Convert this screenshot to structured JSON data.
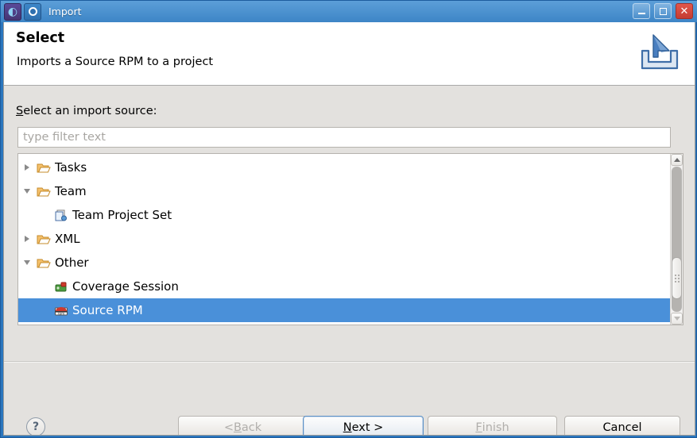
{
  "window": {
    "title": "Import",
    "app_icon": "eclipse-icon",
    "doc_icon": "app-ring-icon",
    "controls": {
      "minimize": "minimize-icon",
      "maximize": "maximize-icon",
      "close": "close-icon",
      "close_glyph": "✕"
    }
  },
  "banner": {
    "title": "Select",
    "subtitle": "Imports a Source RPM to a project",
    "icon": "import-tray-icon"
  },
  "form": {
    "source_label_prefix": "S",
    "source_label_rest": "elect an import source:",
    "filter": {
      "value": "",
      "placeholder": "type filter text"
    }
  },
  "tree": {
    "items": [
      {
        "label": "Tasks",
        "icon": "folder-icon",
        "twisty": "collapsed",
        "depth": 0,
        "selected": false
      },
      {
        "label": "Team",
        "icon": "folder-icon",
        "twisty": "expanded",
        "depth": 0,
        "selected": false
      },
      {
        "label": "Team Project Set",
        "icon": "team-project-set-icon",
        "twisty": "none",
        "depth": 1,
        "selected": false
      },
      {
        "label": "XML",
        "icon": "folder-icon",
        "twisty": "collapsed",
        "depth": 0,
        "selected": false
      },
      {
        "label": "Other",
        "icon": "folder-icon",
        "twisty": "expanded",
        "depth": 0,
        "selected": false
      },
      {
        "label": "Coverage Session",
        "icon": "coverage-session-icon",
        "twisty": "none",
        "depth": 1,
        "selected": false
      },
      {
        "label": "Source RPM",
        "icon": "source-rpm-icon",
        "twisty": "none",
        "depth": 1,
        "selected": true
      }
    ],
    "scrollbar": {
      "up": "scroll-up-icon",
      "down": "scroll-down-icon"
    }
  },
  "buttons": {
    "help": "?",
    "back": {
      "prefix": "< ",
      "mnemonic": "B",
      "suffix": "ack",
      "enabled": false
    },
    "next": {
      "prefix": "",
      "mnemonic": "N",
      "suffix": "ext >",
      "enabled": true,
      "is_default": true
    },
    "finish": {
      "prefix": "",
      "mnemonic": "F",
      "suffix": "inish",
      "enabled": false
    },
    "cancel": {
      "label": "Cancel",
      "enabled": true
    }
  },
  "colors": {
    "titlebar": "#4e93d0",
    "selection": "#4a90d9",
    "dialog_bg": "#e3e1de",
    "close_button": "#c43c32"
  }
}
